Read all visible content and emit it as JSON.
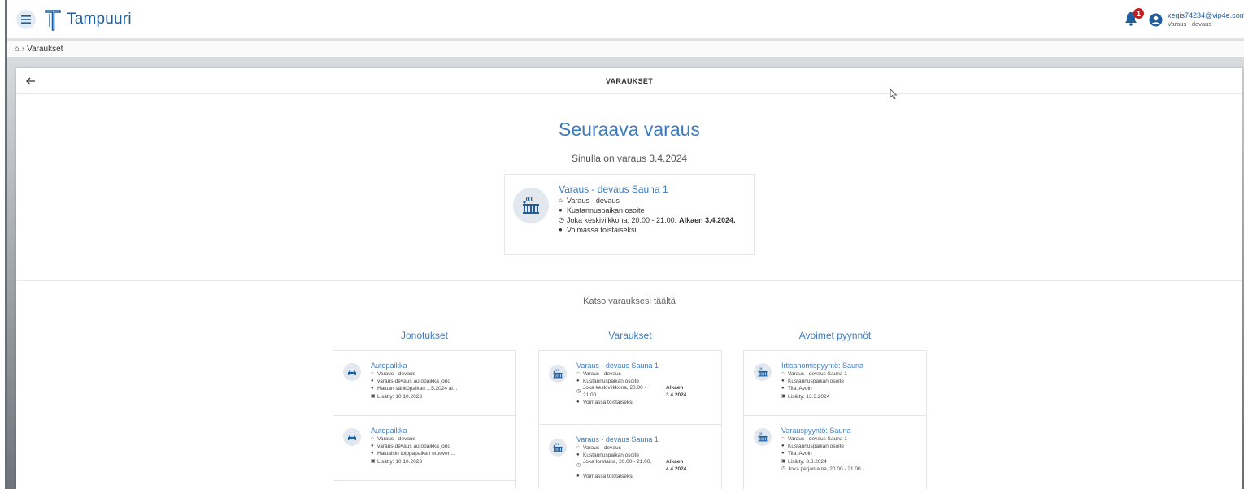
{
  "header": {
    "app_name": "Tampuuri",
    "notification_count": "1",
    "user_email": "xegis74234@vip4e.com",
    "user_subtitle": "Varaus - devaus"
  },
  "breadcrumb": {
    "current": "Varaukset"
  },
  "panel": {
    "title": "VARAUKSET"
  },
  "next_booking": {
    "heading": "Seuraava varaus",
    "subheading": "Sinulla on varaus 3.4.2024",
    "card": {
      "title": "Varaus - devaus Sauna 1",
      "location": "Varaus - devaus",
      "address": "Kustannuspaikan osoite",
      "time": "Joka keskiviikkona, 20.00 - 21.00.",
      "start": "Alkaen 3.4.2024.",
      "validity": "Voimassa toistaiseksi"
    }
  },
  "see_text": "Katso varauksesi täältä",
  "columns": {
    "queue": {
      "title": "Jonotukset",
      "items": [
        {
          "title": "Autopaikka",
          "location": "Varaus - devaus",
          "queue": "varaus-devaus autopaikka jono",
          "note": "Haluan sähköpaikan 1.5.2024 al...",
          "added": "Lisätty: 10.10.2023"
        },
        {
          "title": "Autopaikka",
          "location": "Varaus - devaus",
          "queue": "varaus-devaus autopaikka jono",
          "note": "Haluaisin tolppapaikan etuoven...",
          "added": "Lisätty: 10.10.2023"
        }
      ]
    },
    "bookings": {
      "title": "Varaukset",
      "items": [
        {
          "title": "Varaus - devaus Sauna 1",
          "location": "Varaus - devaus",
          "address": "Kustannuspaikan osoite",
          "time": "Joka keskiviikkona, 20.00 - 21.00.",
          "start": "Alkaen 3.4.2024.",
          "validity": "Voimassa toistaiseksi"
        },
        {
          "title": "Varaus - devaus Sauna 1",
          "location": "Varaus - devaus",
          "address": "Kustannuspaikan osoite",
          "time": "Joka torstaina, 20.00 - 21.00.",
          "start": "Alkaen 4.4.2024.",
          "validity": "Voimassa toistaiseksi"
        }
      ]
    },
    "requests": {
      "title": "Avoimet pyynnöt",
      "items": [
        {
          "title": "Irtisanomispyyntö: Sauna",
          "target": "Varaus - devaus Sauna 1",
          "address": "Kustannuspaikan osoite",
          "status": "Tila: Avoin",
          "added": "Lisätty: 13.3.2024"
        },
        {
          "title": "Varauspyyntö: Sauna",
          "target": "Varaus - devaus Sauna 1",
          "address": "Kustannuspaikan osoite",
          "status": "Tila: Avoin",
          "added": "Lisätty: 8.3.2024",
          "time": "Joka perjantaina, 20.00 - 21.00."
        }
      ]
    }
  },
  "colors": {
    "brand": "#1f5d9d",
    "link": "#3c7bc0",
    "badge": "#c02020",
    "icon_bg": "#e3e8ef"
  },
  "icons": {
    "menu": "hamburger-icon",
    "bell": "bell-icon",
    "user": "user-circle-icon",
    "home": "home-icon",
    "back": "arrow-left-icon",
    "sauna": "sauna-icon",
    "car": "car-icon",
    "pin": "map-pin-icon",
    "clock": "clock-icon",
    "info": "info-icon",
    "calendar": "calendar-icon"
  }
}
